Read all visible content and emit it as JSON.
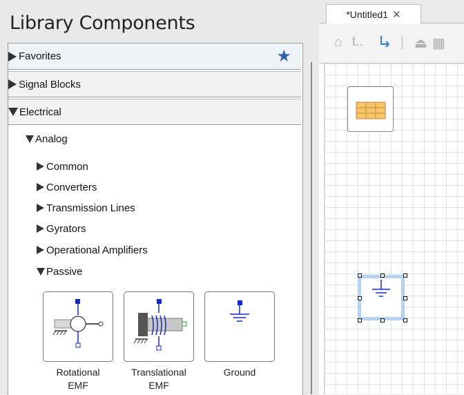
{
  "library": {
    "title": "Library Components",
    "sections": [
      {
        "label": "Favorites",
        "expanded": false,
        "icon": "star-icon"
      },
      {
        "label": "Signal Blocks",
        "expanded": false
      },
      {
        "label": "Electrical",
        "expanded": true
      }
    ],
    "tree": {
      "analog": "Analog",
      "items": [
        "Common",
        "Converters",
        "Transmission Lines",
        "Gyrators",
        "Operational Amplifiers"
      ],
      "passive": "Passive"
    },
    "components": [
      {
        "line1": "Rotational",
        "line2": "EMF"
      },
      {
        "line1": "Translational",
        "line2": "EMF"
      },
      {
        "line1": "Ground",
        "line2": ""
      }
    ]
  },
  "editor": {
    "tab_label": "*Untitled1",
    "toolbar": {
      "up_label": "t.."
    }
  },
  "colors": {
    "accent": "#2f65a8",
    "selection": "#b6d1f2",
    "port": "#1428d0",
    "table_icon": "#f5c56e"
  }
}
